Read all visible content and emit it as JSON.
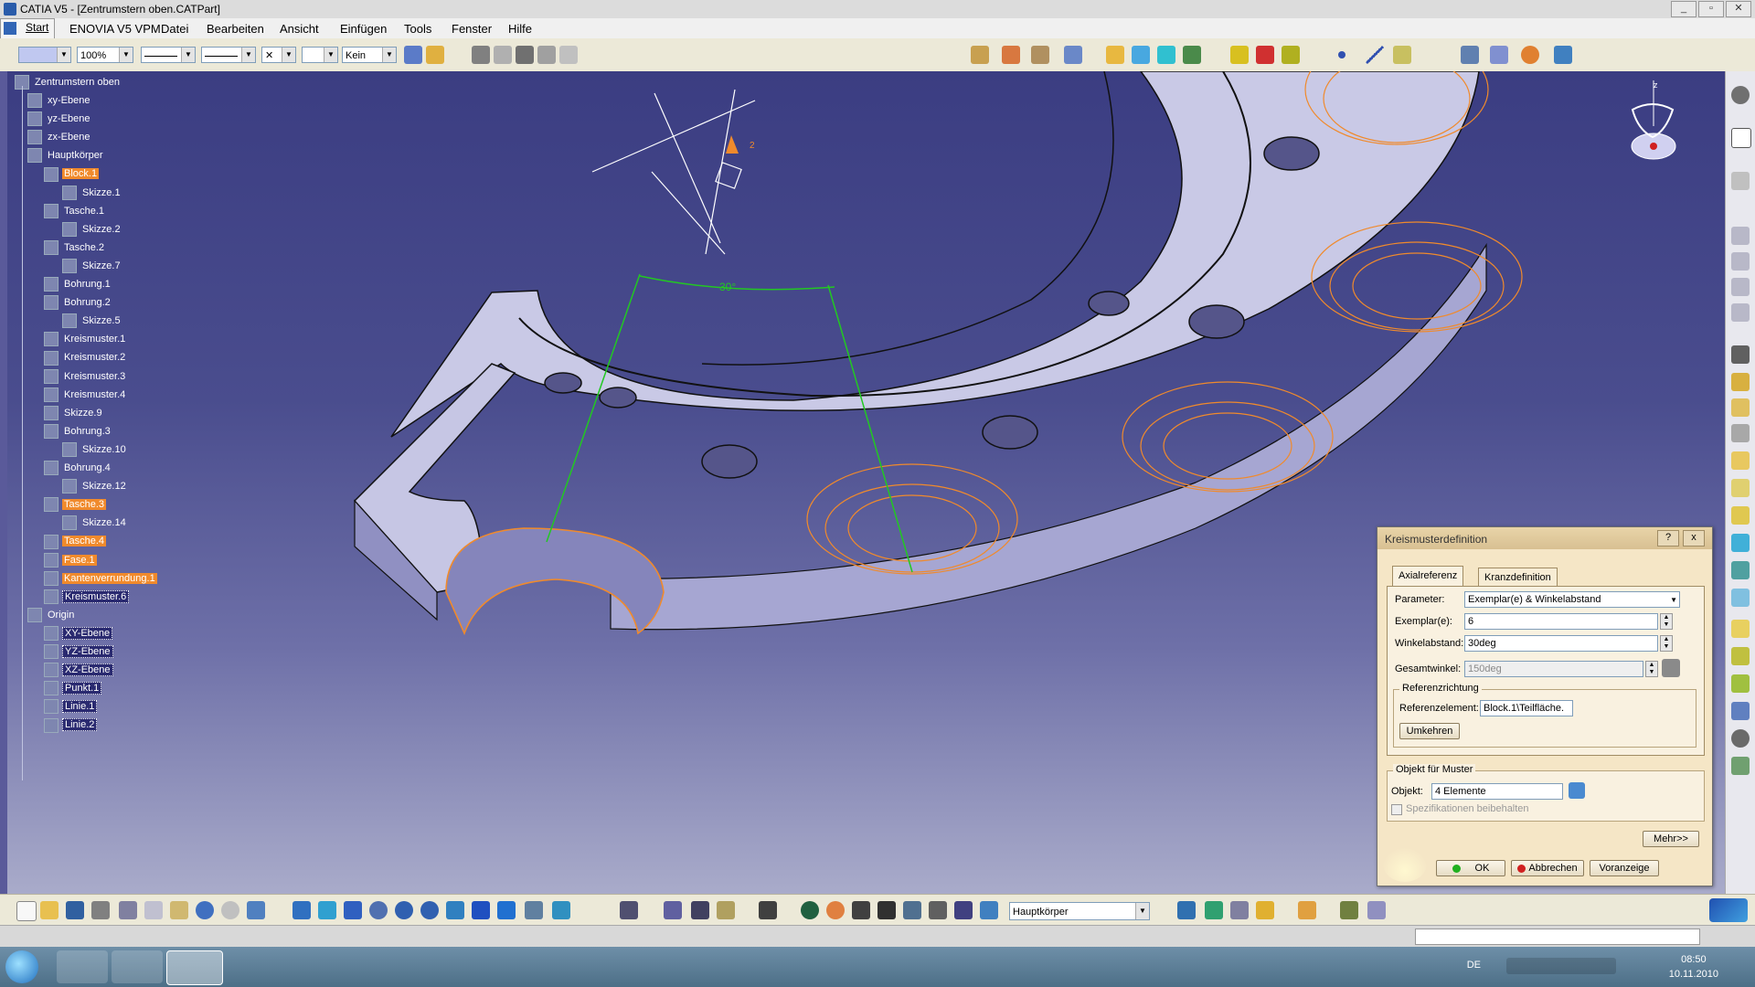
{
  "window": {
    "title": "CATIA V5 - [Zentrumstern oben.CATPart]"
  },
  "menu": [
    "Start",
    "ENOVIA V5 VPM",
    "Datei",
    "Bearbeiten",
    "Ansicht",
    "Einfügen",
    "Tools",
    "Fenster",
    "Hilfe"
  ],
  "toolbar": {
    "zoom": "100%",
    "layer": "Kein"
  },
  "tree": [
    {
      "label": "Zentrumstern oben",
      "level": 0,
      "icon": "part-icon",
      "state": "normal"
    },
    {
      "label": "xy-Ebene",
      "level": 1,
      "icon": "plane-icon",
      "state": "normal"
    },
    {
      "label": "yz-Ebene",
      "level": 1,
      "icon": "plane-icon",
      "state": "normal"
    },
    {
      "label": "zx-Ebene",
      "level": 1,
      "icon": "plane-icon",
      "state": "normal"
    },
    {
      "label": "Hauptkörper",
      "level": 1,
      "icon": "body-icon",
      "state": "normal"
    },
    {
      "label": "Block.1",
      "level": 2,
      "icon": "pad-icon",
      "state": "highlight"
    },
    {
      "label": "Skizze.1",
      "level": 3,
      "icon": "sketch-icon",
      "state": "normal"
    },
    {
      "label": "Tasche.1",
      "level": 2,
      "icon": "pocket-icon",
      "state": "normal"
    },
    {
      "label": "Skizze.2",
      "level": 3,
      "icon": "sketch-icon",
      "state": "normal"
    },
    {
      "label": "Tasche.2",
      "level": 2,
      "icon": "pocket-icon",
      "state": "normal"
    },
    {
      "label": "Skizze.7",
      "level": 3,
      "icon": "sketch-icon",
      "state": "normal"
    },
    {
      "label": "Bohrung.1",
      "level": 2,
      "icon": "hole-icon",
      "state": "normal"
    },
    {
      "label": "Bohrung.2",
      "level": 2,
      "icon": "hole-icon",
      "state": "normal"
    },
    {
      "label": "Skizze.5",
      "level": 3,
      "icon": "sketch-icon",
      "state": "normal"
    },
    {
      "label": "Kreismuster.1",
      "level": 2,
      "icon": "pattern-icon",
      "state": "normal"
    },
    {
      "label": "Kreismuster.2",
      "level": 2,
      "icon": "pattern-icon",
      "state": "normal"
    },
    {
      "label": "Kreismuster.3",
      "level": 2,
      "icon": "pattern-icon",
      "state": "normal"
    },
    {
      "label": "Kreismuster.4",
      "level": 2,
      "icon": "pattern-icon",
      "state": "normal"
    },
    {
      "label": "Skizze.9",
      "level": 2,
      "icon": "sketch-icon",
      "state": "normal"
    },
    {
      "label": "Bohrung.3",
      "level": 2,
      "icon": "hole-icon",
      "state": "normal"
    },
    {
      "label": "Skizze.10",
      "level": 3,
      "icon": "sketch-icon",
      "state": "normal"
    },
    {
      "label": "Bohrung.4",
      "level": 2,
      "icon": "hole-icon",
      "state": "normal"
    },
    {
      "label": "Skizze.12",
      "level": 3,
      "icon": "sketch-icon",
      "state": "normal"
    },
    {
      "label": "Tasche.3",
      "level": 2,
      "icon": "pocket-icon",
      "state": "highlight"
    },
    {
      "label": "Skizze.14",
      "level": 3,
      "icon": "sketch-icon",
      "state": "normal"
    },
    {
      "label": "Tasche.4",
      "level": 2,
      "icon": "pocket-icon",
      "state": "highlight"
    },
    {
      "label": "Fase.1",
      "level": 2,
      "icon": "chamfer-icon",
      "state": "highlight"
    },
    {
      "label": "Kantenverrundung.1",
      "level": 2,
      "icon": "fillet-icon",
      "state": "highlight"
    },
    {
      "label": "Kreismuster.6",
      "level": 2,
      "icon": "pattern-icon",
      "state": "selected"
    },
    {
      "label": "Origin",
      "level": 1,
      "icon": "body-icon",
      "state": "normal"
    },
    {
      "label": "XY-Ebene",
      "level": 2,
      "icon": "plane-icon",
      "state": "selected"
    },
    {
      "label": "YZ-Ebene",
      "level": 2,
      "icon": "plane-icon",
      "state": "selected"
    },
    {
      "label": "XZ-Ebene",
      "level": 2,
      "icon": "plane-icon",
      "state": "selected"
    },
    {
      "label": "Punkt.1",
      "level": 2,
      "icon": "point-icon",
      "state": "selected"
    },
    {
      "label": "Linie.1",
      "level": 2,
      "icon": "line-icon",
      "state": "selected"
    },
    {
      "label": "Linie.2",
      "level": 2,
      "icon": "line-icon",
      "state": "selected"
    }
  ],
  "viewport": {
    "angle_annotation": "30°",
    "compass_axis_label": "2",
    "axis_label_z": "z"
  },
  "dialog": {
    "title": "Kreismusterdefinition",
    "help": "?",
    "close": "x",
    "tabs": [
      "Axialreferenz",
      "Kranzdefinition"
    ],
    "parameter_label": "Parameter:",
    "parameter_value": "Exemplar(e) & Winkelabstand",
    "instances_label": "Exemplar(e):",
    "instances_value": "6",
    "angle_label": "Winkelabstand:",
    "angle_value": "30deg",
    "total_label": "Gesamtwinkel:",
    "total_value": "150deg",
    "ref_group": "Referenzrichtung",
    "ref_label": "Referenzelement:",
    "ref_value": "Block.1\\Teilfläche.",
    "reverse_button": "Umkehren",
    "obj_group": "Objekt für Muster",
    "obj_label": "Objekt:",
    "obj_value": "4 Elemente",
    "keep_specs": "Spezifikationen beibehalten",
    "more_button": "Mehr>>",
    "ok_button": "OK",
    "cancel_button": "Abbrechen",
    "preview_button": "Voranzeige"
  },
  "bottom_toolbar": {
    "body_select": "Hauptkörper"
  },
  "taskbar": {
    "language": "DE",
    "time": "08:50",
    "date": "10.11.2010"
  },
  "colors": {
    "accent": "#f08a2c",
    "viewport_top": "#3b3d82",
    "dialog_bg": "#f5e6c6",
    "part": "#c9c9e6"
  }
}
